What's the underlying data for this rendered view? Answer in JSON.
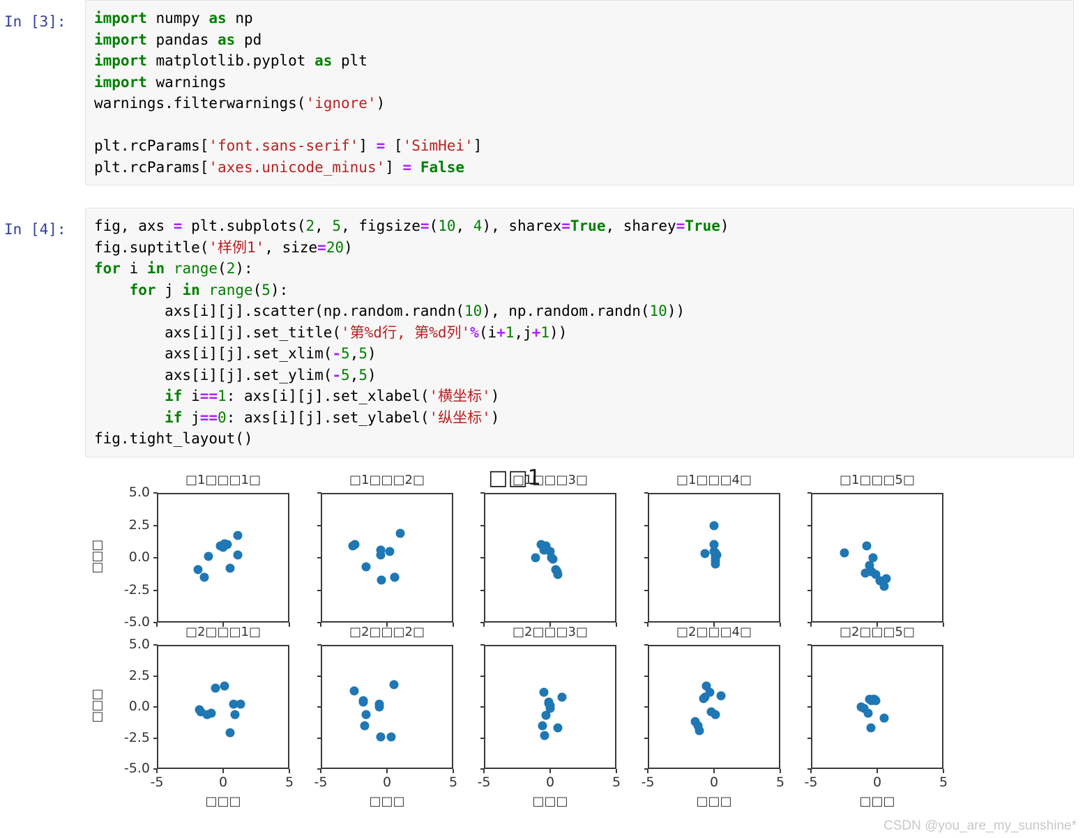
{
  "notebook": {
    "cells": [
      {
        "prompt": "In [3]:",
        "source": "import numpy as np\nimport pandas as pd\nimport matplotlib.pyplot as plt\nimport warnings\nwarnings.filterwarnings('ignore')\n\nplt.rcParams['font.sans-serif'] = ['SimHei']\nplt.rcParams['axes.unicode_minus'] = False"
      },
      {
        "prompt": "In [4]:",
        "source": "fig, axs = plt.subplots(2, 5, figsize=(10, 4), sharex=True, sharey=True)\nfig.suptitle('样例1', size=20)\nfor i in range(2):\n    for j in range(5):\n        axs[i][j].scatter(np.random.randn(10), np.random.randn(10))\n        axs[i][j].set_title('第%d行, 第%d列'%(i+1,j+1))\n        axs[i][j].set_xlim(-5,5)\n        axs[i][j].set_ylim(-5,5)\n        if i==1: axs[i][j].set_xlabel('横坐标')\n        if j==0: axs[i][j].set_ylabel('纵坐标')\nfig.tight_layout()"
      }
    ]
  },
  "watermark": "CSDN @you_are_my_sunshine*",
  "chart_data": {
    "type": "scatter",
    "title": "□□1",
    "title_source": "样例1",
    "note": "Chinese glyphs are missing from the render font and display as tofu boxes (□)",
    "nrows": 2,
    "ncols": 5,
    "figsize": [
      10,
      4
    ],
    "sharex": true,
    "sharey": true,
    "xlim": [
      -5,
      5
    ],
    "ylim": [
      -5,
      5
    ],
    "xticks": [
      -5,
      0,
      5
    ],
    "xtick_labels": [
      "-5",
      "0",
      "5"
    ],
    "yticks": [
      -5.0,
      -2.5,
      0.0,
      2.5,
      5.0
    ],
    "ytick_labels": [
      "-5.0",
      "-2.5",
      "0.0",
      "2.5",
      "5.0"
    ],
    "xlabel": "□□□",
    "xlabel_source": "横坐标",
    "ylabel": "□□□",
    "ylabel_source": "纵坐标",
    "marker_color": "#1f77b4",
    "grid": false,
    "legend": null,
    "panels": [
      {
        "row": 1,
        "col": 1,
        "title": "□1□□□1□",
        "title_source": "第1行, 第1列",
        "points": [
          [
            -1.9,
            -0.9
          ],
          [
            -1.4,
            -1.5
          ],
          [
            -1.1,
            0.1
          ],
          [
            -0.2,
            0.9
          ],
          [
            0.0,
            0.8
          ],
          [
            0.1,
            1.1
          ],
          [
            0.3,
            1.0
          ],
          [
            0.5,
            -0.8
          ],
          [
            1.1,
            1.7
          ],
          [
            1.1,
            0.2
          ]
        ]
      },
      {
        "row": 1,
        "col": 2,
        "title": "□1□□□2□",
        "title_source": "第1行, 第2列",
        "points": [
          [
            -2.6,
            0.9
          ],
          [
            -2.4,
            1.0
          ],
          [
            -1.6,
            -0.7
          ],
          [
            -0.5,
            0.6
          ],
          [
            -0.5,
            0.2
          ],
          [
            -0.4,
            -1.7
          ],
          [
            0.2,
            0.5
          ],
          [
            0.6,
            -1.5
          ],
          [
            1.0,
            1.9
          ],
          [
            0.6,
            -1.5
          ]
        ]
      },
      {
        "row": 1,
        "col": 3,
        "title": "□1□□□3□",
        "title_source": "第1行, 第3列",
        "points": [
          [
            -1.1,
            0.0
          ],
          [
            -0.7,
            1.0
          ],
          [
            -0.5,
            0.6
          ],
          [
            -0.3,
            0.9
          ],
          [
            0.1,
            0.0
          ],
          [
            0.2,
            -0.1
          ],
          [
            0.5,
            -1.1
          ],
          [
            0.6,
            -1.3
          ],
          [
            0.4,
            -0.9
          ],
          [
            0.0,
            0.5
          ]
        ]
      },
      {
        "row": 1,
        "col": 4,
        "title": "□1□□□4□",
        "title_source": "第1行, 第4列",
        "points": [
          [
            -0.7,
            0.3
          ],
          [
            0.0,
            2.5
          ],
          [
            0.0,
            1.0
          ],
          [
            0.1,
            0.4
          ],
          [
            0.1,
            0.1
          ],
          [
            0.1,
            0.0
          ],
          [
            0.1,
            -0.2
          ],
          [
            0.2,
            0.2
          ],
          [
            0.0,
            0.5
          ],
          [
            0.1,
            -0.5
          ]
        ]
      },
      {
        "row": 1,
        "col": 5,
        "title": "□1□□□5□",
        "title_source": "第1行, 第5列",
        "points": [
          [
            -2.5,
            0.4
          ],
          [
            -0.8,
            0.9
          ],
          [
            -0.6,
            -0.6
          ],
          [
            -0.3,
            0.0
          ],
          [
            -0.9,
            -1.2
          ],
          [
            -0.1,
            -1.3
          ],
          [
            0.2,
            -1.8
          ],
          [
            0.5,
            -2.2
          ],
          [
            0.7,
            -1.6
          ],
          [
            -0.4,
            -1.1
          ]
        ]
      },
      {
        "row": 2,
        "col": 1,
        "title": "□2□□□1□",
        "title_source": "第2行, 第1列",
        "points": [
          [
            -1.8,
            -0.2
          ],
          [
            -1.7,
            -0.4
          ],
          [
            -1.2,
            -0.6
          ],
          [
            -0.9,
            -0.5
          ],
          [
            -0.6,
            1.5
          ],
          [
            0.1,
            1.7
          ],
          [
            0.8,
            0.2
          ],
          [
            0.9,
            -0.6
          ],
          [
            1.3,
            0.2
          ],
          [
            0.5,
            -2.1
          ]
        ]
      },
      {
        "row": 2,
        "col": 2,
        "title": "□2□□□2□",
        "title_source": "第2行, 第2列",
        "points": [
          [
            -2.5,
            1.3
          ],
          [
            -1.8,
            0.5
          ],
          [
            -1.6,
            -0.6
          ],
          [
            -1.7,
            -1.5
          ],
          [
            -0.6,
            0.2
          ],
          [
            -0.6,
            0.0
          ],
          [
            -0.5,
            -2.4
          ],
          [
            0.3,
            -2.4
          ],
          [
            0.5,
            1.8
          ],
          [
            -1.8,
            0.4
          ]
        ]
      },
      {
        "row": 2,
        "col": 3,
        "title": "□2□□□3□",
        "title_source": "第2行, 第3列",
        "points": [
          [
            -0.5,
            1.2
          ],
          [
            -0.1,
            0.4
          ],
          [
            0.0,
            0.1
          ],
          [
            0.0,
            -0.1
          ],
          [
            -0.3,
            -0.7
          ],
          [
            -0.6,
            -1.5
          ],
          [
            -0.4,
            -2.3
          ],
          [
            0.6,
            -1.7
          ],
          [
            0.9,
            0.8
          ],
          [
            -0.1,
            0.3
          ]
        ]
      },
      {
        "row": 2,
        "col": 4,
        "title": "□2□□□4□",
        "title_source": "第2行, 第4列",
        "points": [
          [
            -0.6,
            1.7
          ],
          [
            -0.8,
            0.7
          ],
          [
            -0.3,
            1.2
          ],
          [
            0.5,
            0.9
          ],
          [
            -0.2,
            -0.4
          ],
          [
            0.1,
            -0.6
          ],
          [
            -1.4,
            -1.2
          ],
          [
            -1.2,
            -1.5
          ],
          [
            -1.1,
            -1.9
          ],
          [
            -0.7,
            0.8
          ]
        ]
      },
      {
        "row": 2,
        "col": 5,
        "title": "□2□□□5□",
        "title_source": "第2行, 第5列",
        "points": [
          [
            -1.2,
            0.0
          ],
          [
            -1.0,
            -0.1
          ],
          [
            -0.6,
            0.6
          ],
          [
            -0.3,
            0.6
          ],
          [
            -0.2,
            0.6
          ],
          [
            -0.1,
            0.5
          ],
          [
            -0.7,
            -0.5
          ],
          [
            -0.5,
            -1.7
          ],
          [
            0.5,
            -0.9
          ],
          [
            -0.4,
            0.5
          ]
        ]
      }
    ]
  }
}
